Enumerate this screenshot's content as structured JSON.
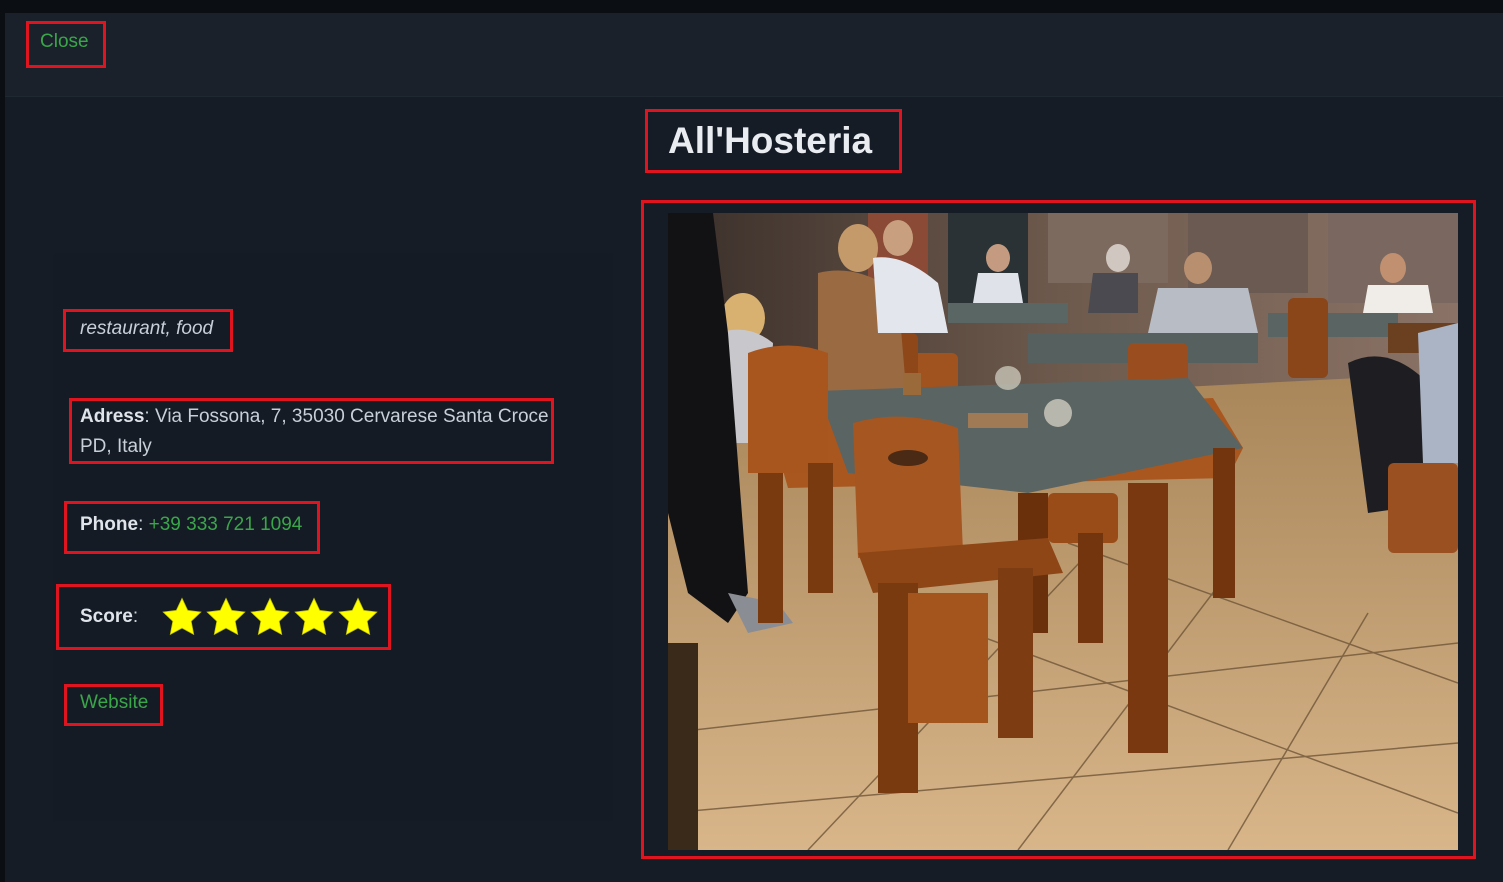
{
  "header": {
    "close_label": "Close"
  },
  "place": {
    "name": "All'Hosteria",
    "categories": "restaurant, food",
    "address_label": "Adress",
    "address_value": "Via Fossona, 7, 35030 Cervarese Santa Croce PD, Italy",
    "phone_label": "Phone",
    "phone_value": "+39 333 721 1094",
    "score_label": "Score",
    "score_value": 5,
    "score_max": 5,
    "website_label": "Website",
    "photo_alt": "restaurant interior"
  },
  "colors": {
    "background": "#161c25",
    "link": "#3aa64a",
    "star": "#ffff00",
    "highlight": "#e0141f"
  },
  "icons": {
    "star": "star-icon",
    "photo": "restaurant-photo"
  }
}
